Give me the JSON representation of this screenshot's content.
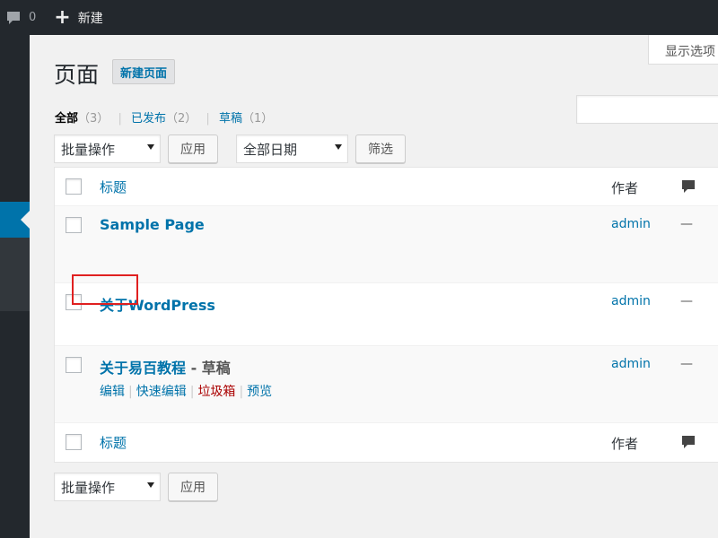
{
  "adminbar": {
    "comments_count": "0",
    "new_label": "新建"
  },
  "screen_options_label": "显示选项",
  "page_title": "页面",
  "add_new_label": "新建页面",
  "filters": {
    "all_label": "全部",
    "all_count": "（3）",
    "published_label": "已发布",
    "published_count": "（2）",
    "draft_label": "草稿",
    "draft_count": "（1）"
  },
  "bulk_actions": {
    "selected": "批量操作",
    "apply_label": "应用"
  },
  "date_filter": {
    "selected": "全部日期",
    "filter_label": "筛选"
  },
  "table": {
    "columns": {
      "title": "标题",
      "author": "作者"
    },
    "rows": [
      {
        "title": "Sample Page",
        "state": "",
        "author": "admin",
        "comments": "—"
      },
      {
        "title": "关于WordPress",
        "state": "",
        "author": "admin",
        "comments": "—"
      },
      {
        "title": "关于易百教程",
        "state": " - 草稿",
        "author": "admin",
        "comments": "—"
      }
    ],
    "row_actions": {
      "edit": "编辑",
      "quick_edit": "快速编辑",
      "trash": "垃圾箱",
      "preview": "预览"
    }
  },
  "colors": {
    "link": "#0073aa",
    "adminbar": "#23282d",
    "trash": "#a00000",
    "highlight": "#e02020"
  }
}
